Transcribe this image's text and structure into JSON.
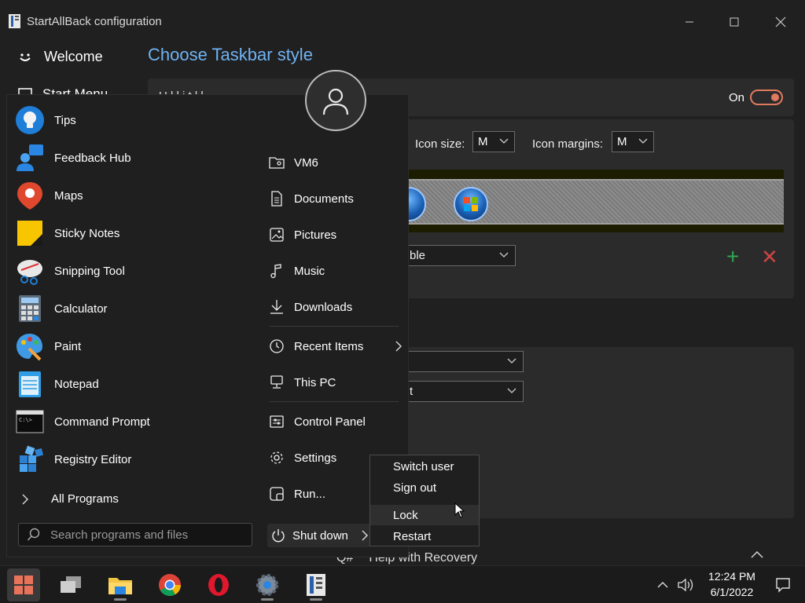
{
  "window": {
    "title": "StartAllBack configuration",
    "nav_welcome": "Welcome",
    "nav_start_menu": "Start Menu",
    "heading": "Choose Taskbar style",
    "cut_text": "U      l      l   i   t   l   l",
    "toggle_label": "On",
    "icon_size_label": "Icon size:",
    "icon_size_value": "M",
    "icon_margins_label": "Icon margins:",
    "icon_margins_value": "M",
    "style_select_value": "ble",
    "select2_value": "",
    "select3_value": "t",
    "help_icon_text": "Q#",
    "help_text": "Help with Recovery",
    "accent_color": "#6fb3f2",
    "toggle_color": "#e07a5f"
  },
  "start_menu": {
    "programs": [
      {
        "label": "Tips",
        "icon": "tips-icon"
      },
      {
        "label": "Feedback Hub",
        "icon": "feedback-hub-icon"
      },
      {
        "label": "Maps",
        "icon": "maps-icon"
      },
      {
        "label": "Sticky Notes",
        "icon": "sticky-notes-icon"
      },
      {
        "label": "Snipping Tool",
        "icon": "snipping-tool-icon"
      },
      {
        "label": "Calculator",
        "icon": "calculator-icon"
      },
      {
        "label": "Paint",
        "icon": "paint-icon"
      },
      {
        "label": "Notepad",
        "icon": "notepad-icon"
      },
      {
        "label": "Command Prompt",
        "icon": "command-prompt-icon"
      },
      {
        "label": "Registry Editor",
        "icon": "registry-editor-icon"
      }
    ],
    "all_programs": "All Programs",
    "search_placeholder": "Search programs and files",
    "right_items": [
      {
        "label": "VM6",
        "icon": "user-folder-icon"
      },
      {
        "label": "Documents",
        "icon": "document-icon"
      },
      {
        "label": "Pictures",
        "icon": "picture-icon"
      },
      {
        "label": "Music",
        "icon": "music-icon"
      },
      {
        "label": "Downloads",
        "icon": "download-icon"
      },
      {
        "label": "Recent Items",
        "icon": "clock-icon"
      },
      {
        "label": "This PC",
        "icon": "computer-icon"
      },
      {
        "label": "Control Panel",
        "icon": "control-panel-icon"
      },
      {
        "label": "Settings",
        "icon": "gear-icon"
      },
      {
        "label": "Run...",
        "icon": "run-icon"
      }
    ],
    "shutdown_label": "Shut down"
  },
  "power_menu": {
    "items": [
      "Switch user",
      "Sign out",
      "Lock",
      "Restart"
    ],
    "highlighted": "Lock"
  },
  "taskbar": {
    "apps": [
      "start-button",
      "task-view",
      "file-explorer",
      "chrome",
      "opera",
      "settings",
      "startallback"
    ],
    "time": "12:24 PM",
    "date": "6/1/2022"
  }
}
